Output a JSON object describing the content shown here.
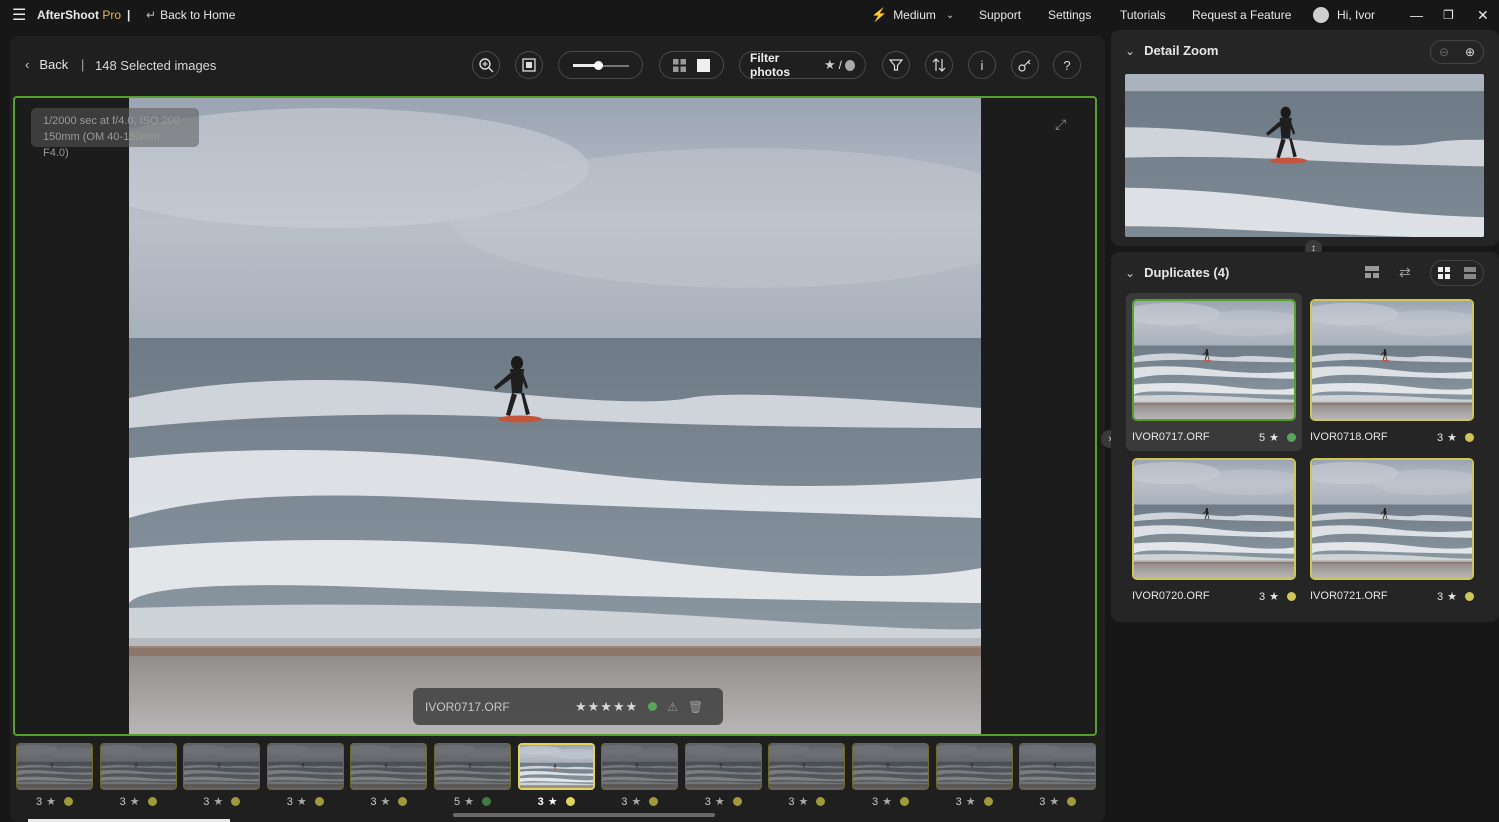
{
  "titlebar": {
    "app_name": "AfterShoot",
    "app_suffix": "Pro",
    "back_home": "Back to Home",
    "mode": "Medium",
    "support": "Support",
    "settings": "Settings",
    "tutorials": "Tutorials",
    "request": "Request a Feature",
    "user": "Hi, Ivor"
  },
  "toolbar": {
    "back": "Back",
    "selected": "148 Selected images",
    "filter_label": "Filter photos",
    "filter_sep": "/",
    "zoom_slider_value": 0.45
  },
  "viewer": {
    "exif_line1": "1/2000 sec at f/4.0, ISO 200",
    "exif_line2": "150mm (OM 40-150mm F4.0)",
    "filename": "IVOR0717.ORF",
    "stars": 5,
    "color_label": "#5aa35a"
  },
  "filmstrip": [
    {
      "rating": "3",
      "color": "#a09a3a"
    },
    {
      "rating": "3",
      "color": "#a09a3a"
    },
    {
      "rating": "3",
      "color": "#a09a3a"
    },
    {
      "rating": "3",
      "color": "#a09a3a"
    },
    {
      "rating": "3",
      "color": "#a09a3a"
    },
    {
      "rating": "5",
      "color": "#3f7a3f"
    },
    {
      "rating": "3",
      "color": "#e0d55a",
      "selected": true
    },
    {
      "rating": "3",
      "color": "#a09a3a"
    },
    {
      "rating": "3",
      "color": "#a09a3a"
    },
    {
      "rating": "3",
      "color": "#a09a3a"
    },
    {
      "rating": "3",
      "color": "#a09a3a"
    },
    {
      "rating": "3",
      "color": "#a09a3a"
    },
    {
      "rating": "3",
      "color": "#a09a3a"
    }
  ],
  "detail_zoom": {
    "title": "Detail Zoom"
  },
  "duplicates": {
    "title": "Duplicates (4)",
    "items": [
      {
        "name": "IVOR0717.ORF",
        "rating": "5",
        "color": "#5aa35a",
        "active": true
      },
      {
        "name": "IVOR0718.ORF",
        "rating": "3",
        "color": "#cfc65a"
      },
      {
        "name": "IVOR0720.ORF",
        "rating": "3",
        "color": "#cfc65a"
      },
      {
        "name": "IVOR0721.ORF",
        "rating": "3",
        "color": "#cfc65a"
      }
    ]
  },
  "colors": {
    "accent_green": "#58a02e",
    "accent_yellow": "#e0d55a",
    "bolt": "#f2c230"
  }
}
